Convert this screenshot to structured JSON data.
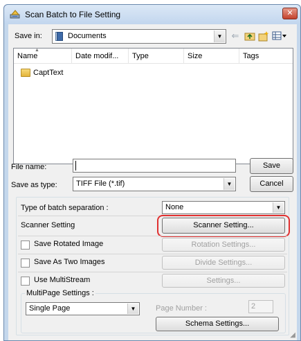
{
  "window": {
    "title": "Scan Batch to File Setting",
    "close_glyph": "✕"
  },
  "toolbar": {
    "save_in_label": "Save in:",
    "location_value": "Documents",
    "back_icon": "back-arrow-icon",
    "up_icon": "up-folder-icon",
    "new_folder_icon": "new-folder-icon",
    "view_menu_icon": "view-menu-icon"
  },
  "filelist": {
    "columns": [
      "Name",
      "Date modif...",
      "Type",
      "Size",
      "Tags"
    ],
    "items": [
      {
        "label": "CaptText",
        "icon": "folder-icon"
      }
    ]
  },
  "file_name": {
    "label": "File name:",
    "value": ""
  },
  "save_as_type": {
    "label": "Save as type:",
    "value": "TIFF File (*.tif)"
  },
  "buttons": {
    "save": "Save",
    "cancel": "Cancel",
    "scanner_setting": "Scanner Setting...",
    "rotation_settings": "Rotation Settings...",
    "divide_settings": "Divide Settings...",
    "settings": "Settings...",
    "schema_settings": "Schema Settings..."
  },
  "batch": {
    "separation_label": "Type of batch separation :",
    "separation_value": "None",
    "scanner_setting_label": "Scanner Setting",
    "save_rotated_label": "Save Rotated Image",
    "save_rotated_checked": false,
    "save_two_label": "Save As Two Images",
    "save_two_checked": false,
    "multistream_label": "Use MultiStream",
    "multistream_checked": false
  },
  "multipage": {
    "group_label": "MultiPage Settings :",
    "mode_value": "Single Page",
    "page_number_label": "Page Number :",
    "page_number_value": "2"
  },
  "colors": {
    "highlight": "#e03030",
    "window_frame": "#c4d7ec",
    "client_bg": "#f0f0f0",
    "disabled_text": "#a0a0a0"
  }
}
